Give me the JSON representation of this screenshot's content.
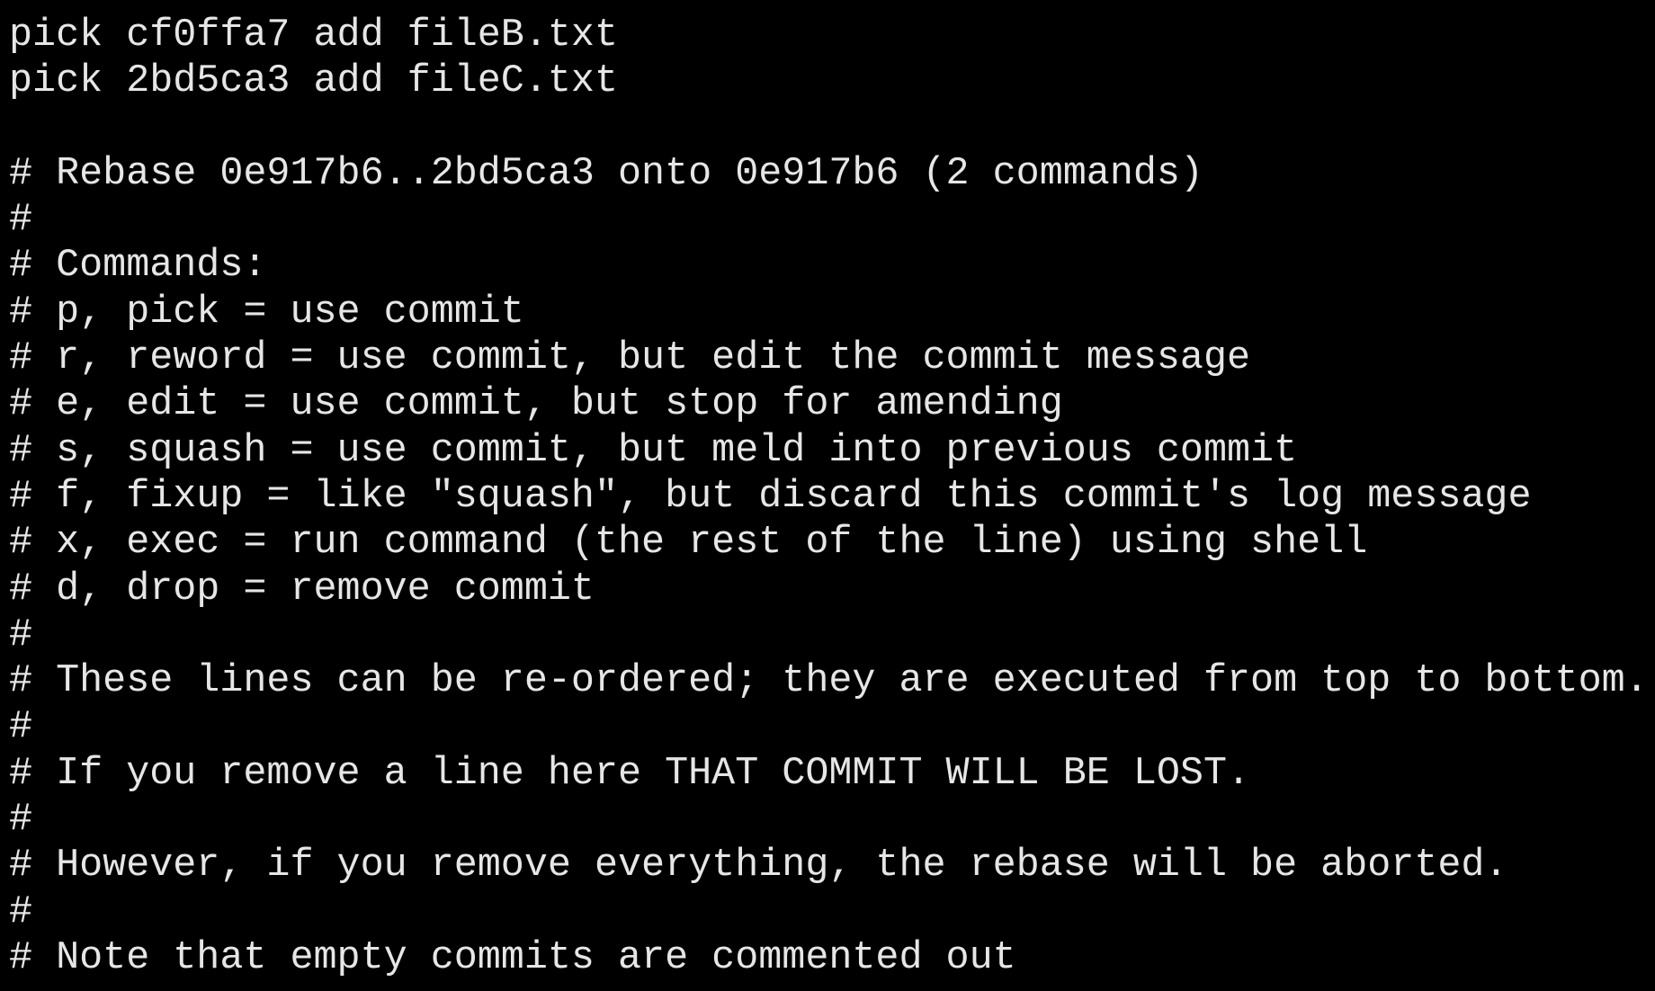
{
  "editor": {
    "lines": [
      "pick cf0ffa7 add fileB.txt",
      "pick 2bd5ca3 add fileC.txt",
      "",
      "# Rebase 0e917b6..2bd5ca3 onto 0e917b6 (2 commands)",
      "#",
      "# Commands:",
      "# p, pick = use commit",
      "# r, reword = use commit, but edit the commit message",
      "# e, edit = use commit, but stop for amending",
      "# s, squash = use commit, but meld into previous commit",
      "# f, fixup = like \"squash\", but discard this commit's log message",
      "# x, exec = run command (the rest of the line) using shell",
      "# d, drop = remove commit",
      "#",
      "# These lines can be re-ordered; they are executed from top to bottom.",
      "#",
      "# If you remove a line here THAT COMMIT WILL BE LOST.",
      "#",
      "# However, if you remove everything, the rebase will be aborted.",
      "#",
      "# Note that empty commits are commented out"
    ]
  },
  "colors": {
    "background": "#000000",
    "foreground": "#e6e6e6"
  }
}
